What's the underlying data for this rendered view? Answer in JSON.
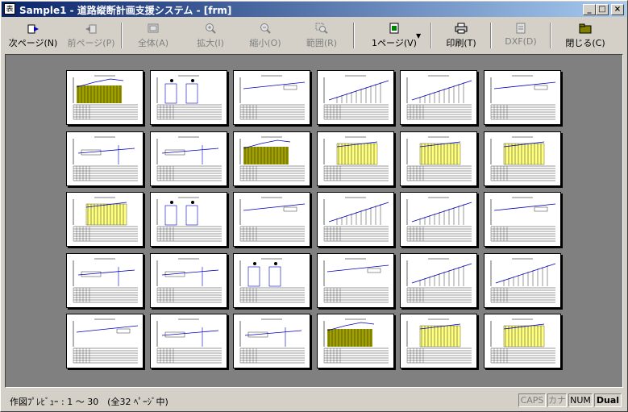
{
  "window": {
    "title": "Sample1 - 道路縦断計画支援システム - [frm]",
    "app_icon": "表",
    "controls": {
      "minimize": "_",
      "maximize": "□",
      "close": "×"
    }
  },
  "toolbar": {
    "next_page": {
      "label": "次ページ(N)",
      "icon": "next-page-icon"
    },
    "prev_page": {
      "label": "前ページ(P)",
      "icon": "prev-page-icon"
    },
    "whole": {
      "label": "全体(A)",
      "icon": "whole-view-icon"
    },
    "zoom_in": {
      "label": "拡大(I)",
      "icon": "zoom-in-icon"
    },
    "zoom_out": {
      "label": "縮小(O)",
      "icon": "zoom-out-icon"
    },
    "range": {
      "label": "範囲(R)",
      "icon": "range-zoom-icon"
    },
    "pages_mode": {
      "label": "1ページ(V)",
      "icon": "page-mode-icon"
    },
    "print": {
      "label": "印刷(T)",
      "icon": "printer-icon"
    },
    "dxf": {
      "label": "DXF(D)",
      "icon": "dxf-icon"
    },
    "close": {
      "label": "閉じる(C)",
      "icon": "close-folder-icon"
    }
  },
  "preview": {
    "background": "#808080",
    "page_count_shown": 30,
    "thumbnail_types": [
      "profile-rising",
      "profile-flat",
      "profile-filled-yellow",
      "profile-partial-yellow",
      "profile-small",
      "profile-stations"
    ]
  },
  "status": {
    "text": "作図ﾌﾟﾚﾋﾞｭｰ : 1 〜 30　(全32 ﾍﾟｰｼﾞ中)",
    "indicators": [
      {
        "label": "CAPS",
        "state": "off"
      },
      {
        "label": "カナ",
        "state": "off"
      },
      {
        "label": "NUM",
        "state": "on"
      },
      {
        "label": "Dual",
        "state": "on"
      }
    ]
  }
}
